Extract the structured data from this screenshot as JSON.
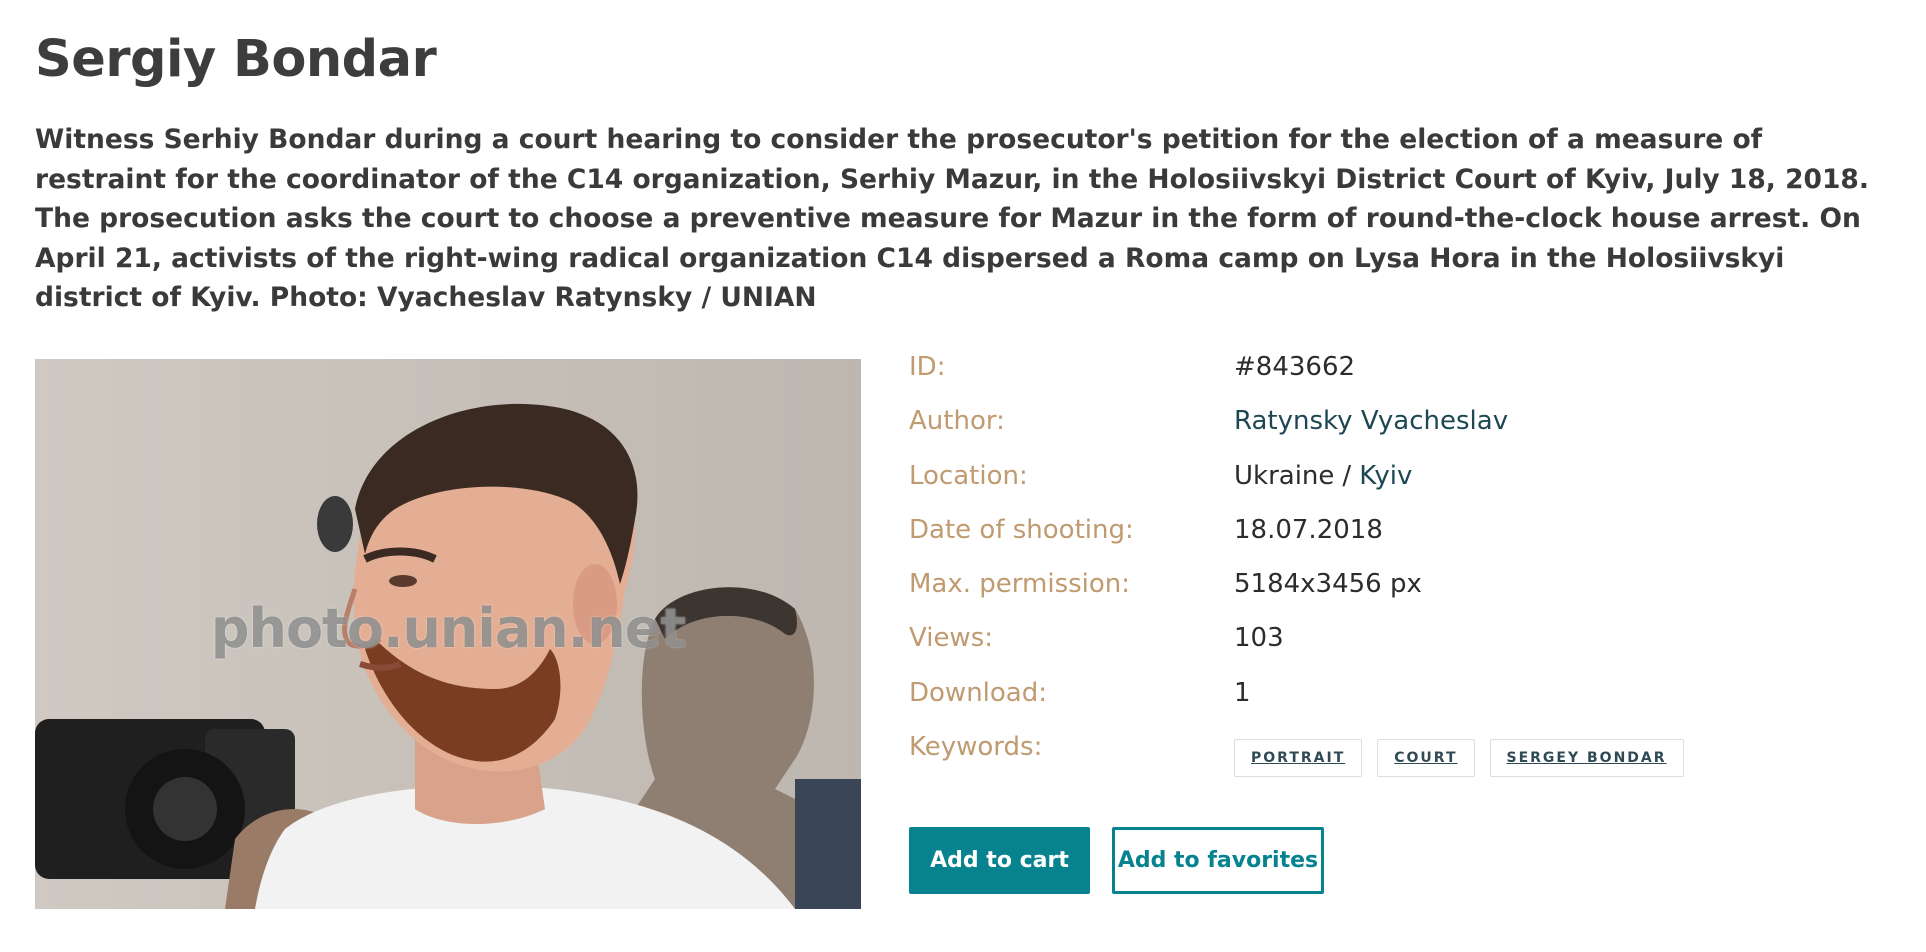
{
  "photo": {
    "title": "Sergiy Bondar",
    "caption": "Witness Serhiy Bondar during a court hearing to consider the prosecutor's petition for the election of a measure of restraint for the coordinator of the C14 organization, Serhiy Mazur, in the Holosiivskyi District Court of Kyiv, July 18, 2018. The prosecution asks the court to choose a preventive measure for Mazur in the form of round-the-clock house arrest. On April 21, activists of the right-wing radical organization C14 dispersed a Roma camp on Lysa Hora in the Holosiivskyi district of Kyiv. Photo: Vyacheslav Ratynsky / UNIAN",
    "watermark": "photo.unian.net"
  },
  "meta": {
    "id_label": "ID:",
    "id_value": "#843662",
    "author_label": "Author:",
    "author_value": "Ratynsky Vyacheslav",
    "location_label": "Location:",
    "location_country": "Ukraine",
    "location_separator": "/",
    "location_city": "Kyiv",
    "date_label": "Date of shooting:",
    "date_value": "18.07.2018",
    "resolution_label": "Max. permission:",
    "resolution_value": "5184x3456 px",
    "views_label": "Views:",
    "views_value": "103",
    "downloads_label": "Download:",
    "downloads_value": "1",
    "keywords_label": "Keywords:",
    "keywords": [
      "PORTRAIT",
      "COURT",
      "SERGEY BONDAR"
    ]
  },
  "actions": {
    "add_to_cart": "Add to cart",
    "add_to_favorites": "Add to favorites"
  },
  "colors": {
    "accent": "#078390",
    "label": "#c09a70",
    "link": "#1e4754",
    "title": "#3d3d3d"
  }
}
